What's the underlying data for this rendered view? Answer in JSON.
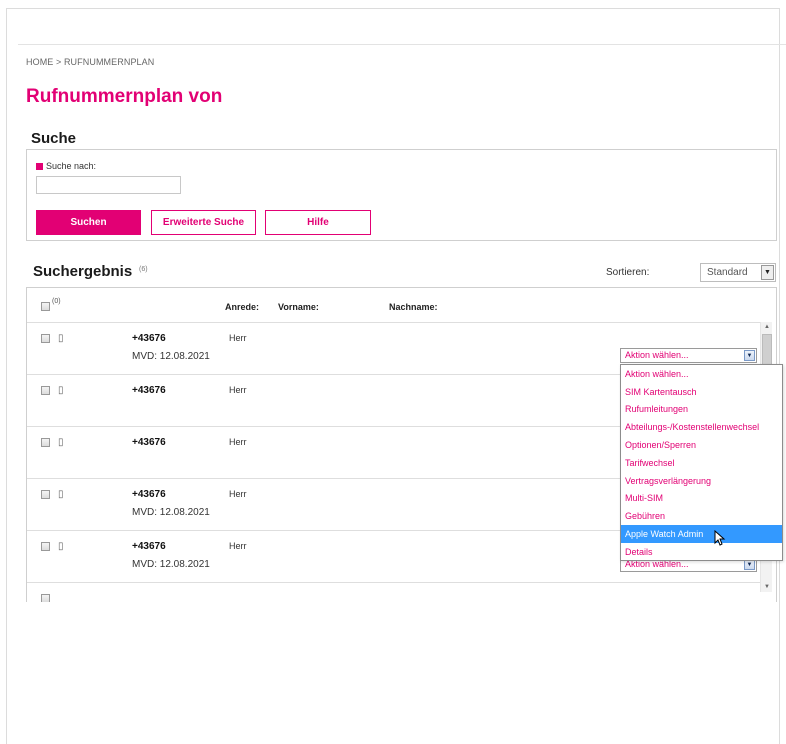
{
  "breadcrumb": "HOME > RUFNUMMERNPLAN",
  "page_title": "Rufnummernplan von",
  "search": {
    "heading": "Suche",
    "field_label": "Suche nach:",
    "value": "",
    "buttons": {
      "search": "Suchen",
      "advanced": "Erweiterte Suche",
      "help": "Hilfe"
    }
  },
  "results": {
    "heading": "Suchergebnis",
    "count": "(6)",
    "sort_label": "Sortieren:",
    "sort_value": "Standard",
    "header_count": "(0)",
    "columns": {
      "anrede": "Anrede:",
      "vorname": "Vorname:",
      "nachname": "Nachname:"
    },
    "rows": [
      {
        "number": "+43676",
        "mvd": "MVD: 12.08.2021",
        "anrede": "Herr"
      },
      {
        "number": "+43676",
        "mvd": "",
        "anrede": "Herr"
      },
      {
        "number": "+43676",
        "mvd": "",
        "anrede": "Herr"
      },
      {
        "number": "+43676",
        "mvd": "MVD: 12.08.2021",
        "anrede": "Herr"
      },
      {
        "number": "+43676",
        "mvd": "MVD: 12.08.2021",
        "anrede": "Herr"
      }
    ],
    "action_placeholder": "Aktion wählen...",
    "action_options": [
      "Aktion wählen...",
      "SIM Kartentausch",
      "Rufumleitungen",
      "Abteilungs-/Kostenstellenwechsel",
      "Optionen/Sperren",
      "Tarifwechsel",
      "Vertragsverlängerung",
      "Multi-SIM",
      "Gebühren",
      "Apple Watch Admin",
      "Details"
    ],
    "highlighted_option": "Apple Watch Admin"
  },
  "colors": {
    "brand": "#e20074",
    "highlight": "#3399ff"
  },
  "icons": {
    "row": "phone-icon",
    "select": "chevron-down-icon",
    "pointer": "cursor-icon"
  }
}
